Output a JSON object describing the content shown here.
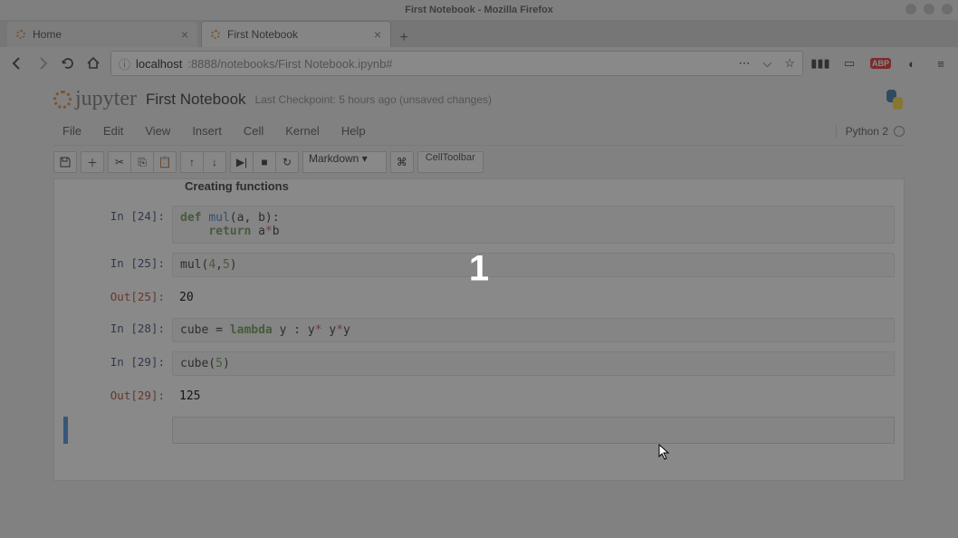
{
  "window": {
    "title": "First Notebook - Mozilla Firefox"
  },
  "tabs": [
    {
      "label": "Home"
    },
    {
      "label": "First Notebook"
    }
  ],
  "url": {
    "info_icon": "ⓘ",
    "host": "localhost",
    "rest": ":8888/notebooks/First Notebook.ipynb#"
  },
  "notebook": {
    "logo_text": "jupyter",
    "title": "First Notebook",
    "checkpoint": "Last Checkpoint: 5 hours ago (unsaved changes)",
    "menu": [
      "File",
      "Edit",
      "View",
      "Insert",
      "Cell",
      "Kernel",
      "Help"
    ],
    "kernel": "Python 2",
    "cell_type_selected": "Markdown",
    "celltoolbar_label": "CellToolbar",
    "section_heading": "Creating functions"
  },
  "cells": [
    {
      "in_prompt": "In [24]:",
      "code_html": "<span class='kw-def'>def</span> <span class='func-name'>mul</span>(a, b):\n    <span class='kw-ret'>return</span> a<span class='op'>*</span>b"
    },
    {
      "in_prompt": "In [25]:",
      "code_html": "mul(<span class='num'>4</span>,<span class='num'>5</span>)",
      "out_prompt": "Out[25]:",
      "out_text": "20"
    },
    {
      "in_prompt": "In [28]:",
      "code_html": "cube = <span class='kw-lambda'>lambda</span> y : y<span class='op'>*</span> y<span class='op'>*</span>y"
    },
    {
      "in_prompt": "In [29]:",
      "code_html": "cube(<span class='num'>5</span>)",
      "out_prompt": "Out[29]:",
      "out_text": "125"
    }
  ],
  "overlay": {
    "number": "1"
  }
}
